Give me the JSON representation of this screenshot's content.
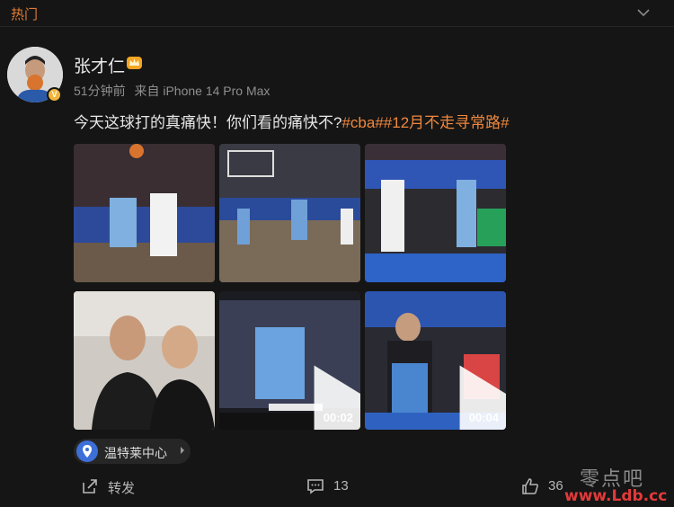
{
  "header": {
    "title": "热门",
    "collapse_icon": "chevron-down-icon"
  },
  "post": {
    "author": "张才仁",
    "badge": "crown-icon",
    "verified": "V",
    "time": "51分钟前",
    "source": "来自 iPhone 14 Pro Max",
    "text_plain": "今天这球打的真痛快！你们看的痛快不?",
    "hashtags": "#cba##12月不走寻常路#",
    "media": [
      {
        "kind": "photo"
      },
      {
        "kind": "photo"
      },
      {
        "kind": "photo"
      },
      {
        "kind": "photo"
      },
      {
        "kind": "video",
        "duration": "00:02"
      },
      {
        "kind": "video",
        "duration": "00:04"
      }
    ],
    "location": "温特莱中心"
  },
  "actions": {
    "repost_label": "转发",
    "comment_count": "13",
    "like_count": "36"
  },
  "watermark": {
    "text": "零点吧",
    "url": "www.Ldb.cc"
  },
  "colors": {
    "accent": "#f0883e",
    "background": "#151515",
    "verified": "#f2b53c",
    "location_pin": "#3d6fd8"
  }
}
